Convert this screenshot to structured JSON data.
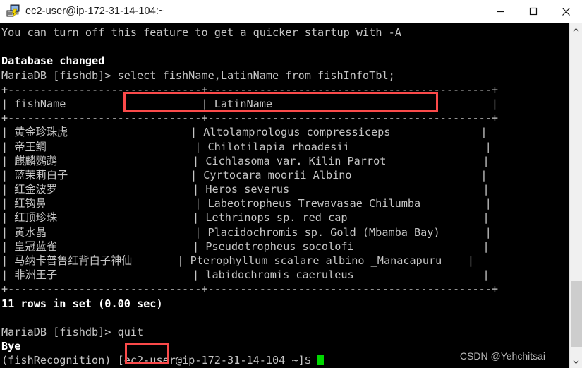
{
  "window": {
    "title": "ec2-user@ip-172-31-14-104:~",
    "icon": "putty-terminal-icon",
    "controls": {
      "minimize": "minimize-icon",
      "maximize": "maximize-icon",
      "close": "close-icon"
    }
  },
  "terminal": {
    "background_color": "#000000",
    "text_color": "#c6c6c6",
    "cursor_color": "#00d800",
    "highlight_color": "#fb4a4a",
    "lines": [
      "You can turn off this feature to get a quicker startup with -A",
      "",
      "Database changed",
      "MariaDB [fishdb]> select fishName,LatinName from fishInfoTbl;",
      "+------------------------------+--------------------------------------------+",
      "| fishName                     | LatinName                                  |",
      "+------------------------------+--------------------------------------------+",
      "| 黄金珍珠虎                   | Altolamprologus compressiceps              |",
      "| 帝王鲷                       | Chilotilapia rhoadesii                     |",
      "| 麒麟鹦鹉                     | Cichlasoma var. Kilin Parrot               |",
      "| 蓝茉莉白子                   | Cyrtocara moorii Albino                    |",
      "| 红金波罗                     | Heros severus                              |",
      "| 红钩鼻                       | Labeotropheus Trewavasae Chilumba          |",
      "| 红顶珍珠                     | Lethrinops sp. red cap                     |",
      "| 黄水晶                       | Placidochromis sp. Gold (Mbamba Bay)       |",
      "| 皇冠蓝雀                     | Pseudotropheus socolofi                    |",
      "| 马纳卡普鲁红背白子神仙       | Pterophyllum scalare albino _Manacapuru    |",
      "| 非洲王子                     | labidochromis caeruleus                    |",
      "+------------------------------+--------------------------------------------+",
      "11 rows in set (0.00 sec)",
      "",
      "MariaDB [fishdb]> quit",
      "Bye",
      "(fishRecognition) [ec2-user@ip-172-31-14-104 ~]$ "
    ],
    "bold_lines": [
      2,
      19,
      22
    ],
    "query_command": "select fishName,LatinName from fishInfoTbl;",
    "quit_command": "quit",
    "prompt_mariadb": "MariaDB [fishdb]> ",
    "prompt_shell": "(fishRecognition) [ec2-user@ip-172-31-14-104 ~]$ ",
    "result_summary": "11 rows in set (0.00 sec)",
    "exit_message": "Bye",
    "database_changed": "Database changed",
    "startup_hint": "You can turn off this feature to get a quicker startup with -A"
  },
  "table_result": {
    "columns": [
      "fishName",
      "LatinName"
    ],
    "rows": [
      {
        "fishName": "黄金珍珠虎",
        "LatinName": "Altolamprologus compressiceps"
      },
      {
        "fishName": "帝王鲷",
        "LatinName": "Chilotilapia rhoadesii"
      },
      {
        "fishName": "麒麟鹦鹉",
        "LatinName": "Cichlasoma var. Kilin Parrot"
      },
      {
        "fishName": "蓝茉莉白子",
        "LatinName": "Cyrtocara moorii Albino"
      },
      {
        "fishName": "红金波罗",
        "LatinName": "Heros severus"
      },
      {
        "fishName": "红钩鼻",
        "LatinName": "Labeotropheus Trewavasae Chilumba"
      },
      {
        "fishName": "红顶珍珠",
        "LatinName": "Lethrinops sp. red cap"
      },
      {
        "fishName": "黄水晶",
        "LatinName": "Placidochromis sp. Gold (Mbamba Bay)"
      },
      {
        "fishName": "皇冠蓝雀",
        "LatinName": "Pseudotropheus socolofi"
      },
      {
        "fishName": "马纳卡普鲁红背白子神仙",
        "LatinName": "Pterophyllum scalare albino _Manacapuru"
      },
      {
        "fishName": "非洲王子",
        "LatinName": "labidochromis caeruleus"
      }
    ],
    "row_count": 11
  },
  "watermark": {
    "text": "CSDN @Yehchitsai"
  },
  "scrollbar": {
    "up_arrow": "chevron-up-icon",
    "down_arrow": "chevron-down-icon"
  }
}
